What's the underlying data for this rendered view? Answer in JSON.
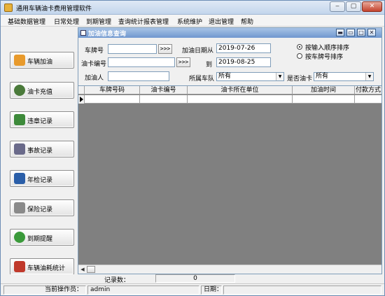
{
  "window": {
    "title": "通用车辆油卡费用管理软件",
    "controls": {
      "minimize": "‒",
      "maximize": "▢",
      "close": "✕"
    }
  },
  "menu": [
    "基础数据管理",
    "日常处理",
    "到期管理",
    "查询统计报表管理",
    "系统维护",
    "退出管理",
    "帮助"
  ],
  "sidebar": [
    {
      "label": "车辆加油",
      "icon": "fuel-pump-icon",
      "color": "#e89a2c"
    },
    {
      "label": "油卡充值",
      "icon": "money-bag-icon",
      "color": "#4a7a3a"
    },
    {
      "label": "违章记录",
      "icon": "violation-doc-icon",
      "color": "#3d8a3a"
    },
    {
      "label": "事故记录",
      "icon": "wrench-icon",
      "color": "#6a6a8a"
    },
    {
      "label": "年检记录",
      "icon": "inspection-icon",
      "color": "#2a5ea8"
    },
    {
      "label": "保险记录",
      "icon": "printer-icon",
      "color": "#8a8a8a"
    },
    {
      "label": "到期提醒",
      "icon": "clock-icon",
      "color": "#3a9a3a"
    },
    {
      "label": "车辆油耗统计",
      "icon": "report-icon",
      "color": "#c0392b"
    }
  ],
  "panel": {
    "title": "加油信息查询",
    "controls": {
      "minimize": "▬",
      "restore": "▭",
      "maximize": "□",
      "close": "✕"
    }
  },
  "form": {
    "plate_label": "车牌号",
    "plate_value": "",
    "card_label": "油卡编号",
    "card_value": "",
    "arrow_btn": ">>>",
    "refueler_label": "加油人",
    "refueler_value": "",
    "date_from_label": "加油日期从",
    "date_from": "2019-07-26",
    "date_to_label": "到",
    "date_to": "2019-08-25",
    "team_label": "所属车队",
    "team_value": "所有",
    "is_card_label": "是否油卡",
    "is_card_value": "所有",
    "sort_options": [
      {
        "label": "按输入顺序排序",
        "selected": true
      },
      {
        "label": "按车牌号排序",
        "selected": false
      }
    ]
  },
  "grid": {
    "columns": [
      "车牌号码",
      "油卡编号",
      "油卡所在单位",
      "加油时间",
      "付款方式"
    ],
    "rows": [
      [
        "",
        "",
        "",
        "",
        ""
      ]
    ]
  },
  "footer": {
    "record_count_label": "记录数：",
    "record_count": "0",
    "operator_label": "当前操作员：",
    "operator": "admin",
    "date_label": "日期："
  }
}
